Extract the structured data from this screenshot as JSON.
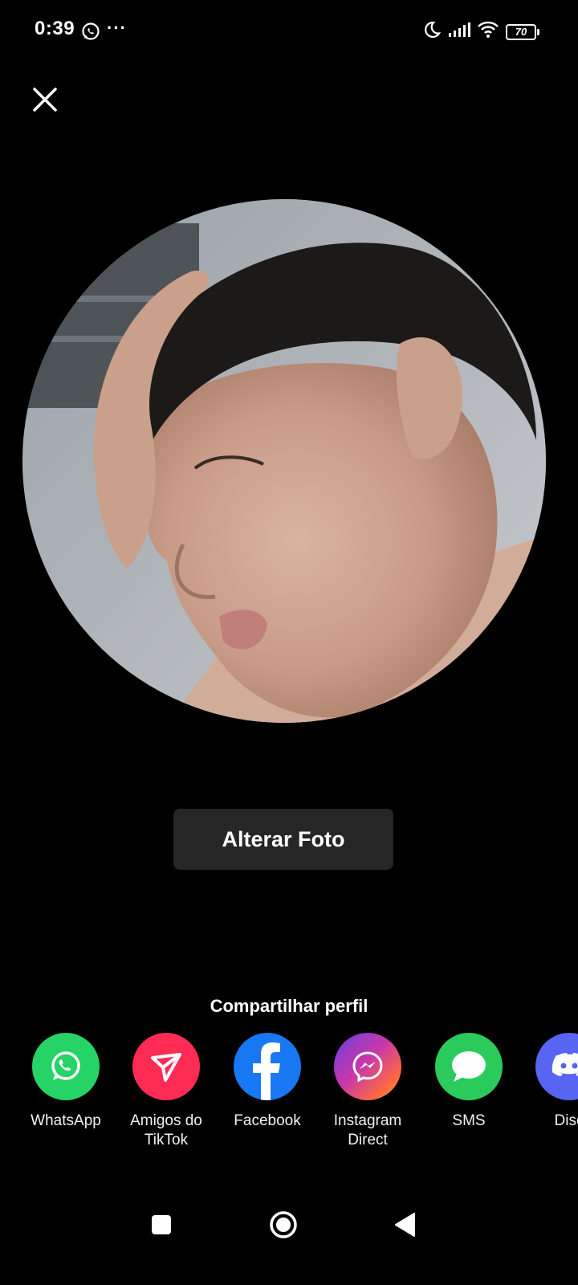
{
  "status_bar": {
    "time": "0:39",
    "dots": "···",
    "battery": "70"
  },
  "main": {
    "change_photo_label": "Alterar Foto",
    "share_title": "Compartilhar perfil"
  },
  "share_targets": [
    {
      "label": "WhatsApp",
      "icon": "whatsapp-icon",
      "color": "#25D366"
    },
    {
      "label": "Amigos do TikTok",
      "icon": "send-icon",
      "color": "#FE2C55"
    },
    {
      "label": "Facebook",
      "icon": "facebook-icon",
      "color": "#1877F2"
    },
    {
      "label": "Instagram Direct",
      "icon": "messenger-icon",
      "color": "#C837AB"
    },
    {
      "label": "SMS",
      "icon": "sms-icon",
      "color": "#2BCB5B"
    },
    {
      "label": "Disc",
      "icon": "discord-icon",
      "color": "#5865F2"
    }
  ]
}
